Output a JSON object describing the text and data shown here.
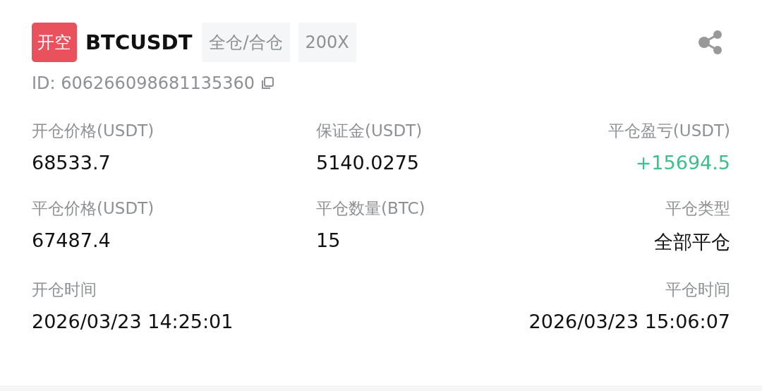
{
  "order": {
    "side": "开空",
    "symbol": "BTCUSDT",
    "tags": [
      "全仓/合仓",
      "200X"
    ],
    "id": "ID: 606266098681135360"
  },
  "rows": [
    {
      "cells": [
        {
          "label": "开仓价格(USDT)",
          "value": "68533.7",
          "kind": "plain"
        },
        {
          "label": "保证金(USDT)",
          "value": "5140.0275",
          "kind": "plain"
        },
        {
          "label": "平仓盈亏(USDT)",
          "value": "+15694.5",
          "kind": "profit"
        }
      ]
    },
    {
      "cells": [
        {
          "label": "平仓价格(USDT)",
          "value": "67487.4",
          "kind": "plain"
        },
        {
          "label": "平仓数量(BTC)",
          "value": "15",
          "kind": "plain"
        },
        {
          "label": "平仓类型",
          "value": "全部平仓",
          "kind": "plain"
        }
      ]
    },
    {
      "cells": [
        {
          "label": "开仓时间",
          "value": "2026/03/23 14:25:01",
          "kind": "plain"
        },
        {
          "label": "平仓时间",
          "value": "2026/03/23 15:06:07",
          "kind": "plain"
        }
      ]
    }
  ]
}
